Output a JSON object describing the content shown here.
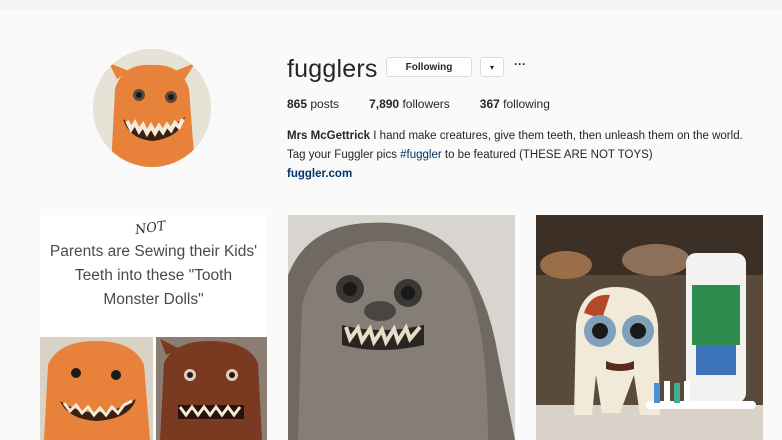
{
  "profile": {
    "username": "fugglers",
    "follow_button": "Following",
    "dropdown_icon": "▾",
    "more_icon": "···"
  },
  "stats": {
    "posts_count": "865",
    "posts_label": "posts",
    "followers_count": "7,890",
    "followers_label": "followers",
    "following_count": "367",
    "following_label": "following"
  },
  "bio": {
    "name": "Mrs McGettrick",
    "text_before_tag": " I hand make creatures, give them teeth, then unleash them on the world. Tag your Fuggler pics ",
    "hashtag": "#fuggler",
    "text_after_tag": " to be featured (THESE ARE NOT TOYS)",
    "link": "fuggler.com"
  },
  "posts": {
    "meme_not": "NOT",
    "meme_line1": "Parents are Sewing their Kids'",
    "meme_line2": "Teeth into these \"Tooth",
    "meme_line3": "Monster Dolls\""
  },
  "colors": {
    "link": "#003569",
    "border": "#dbdbdb",
    "background": "#fafafa"
  }
}
